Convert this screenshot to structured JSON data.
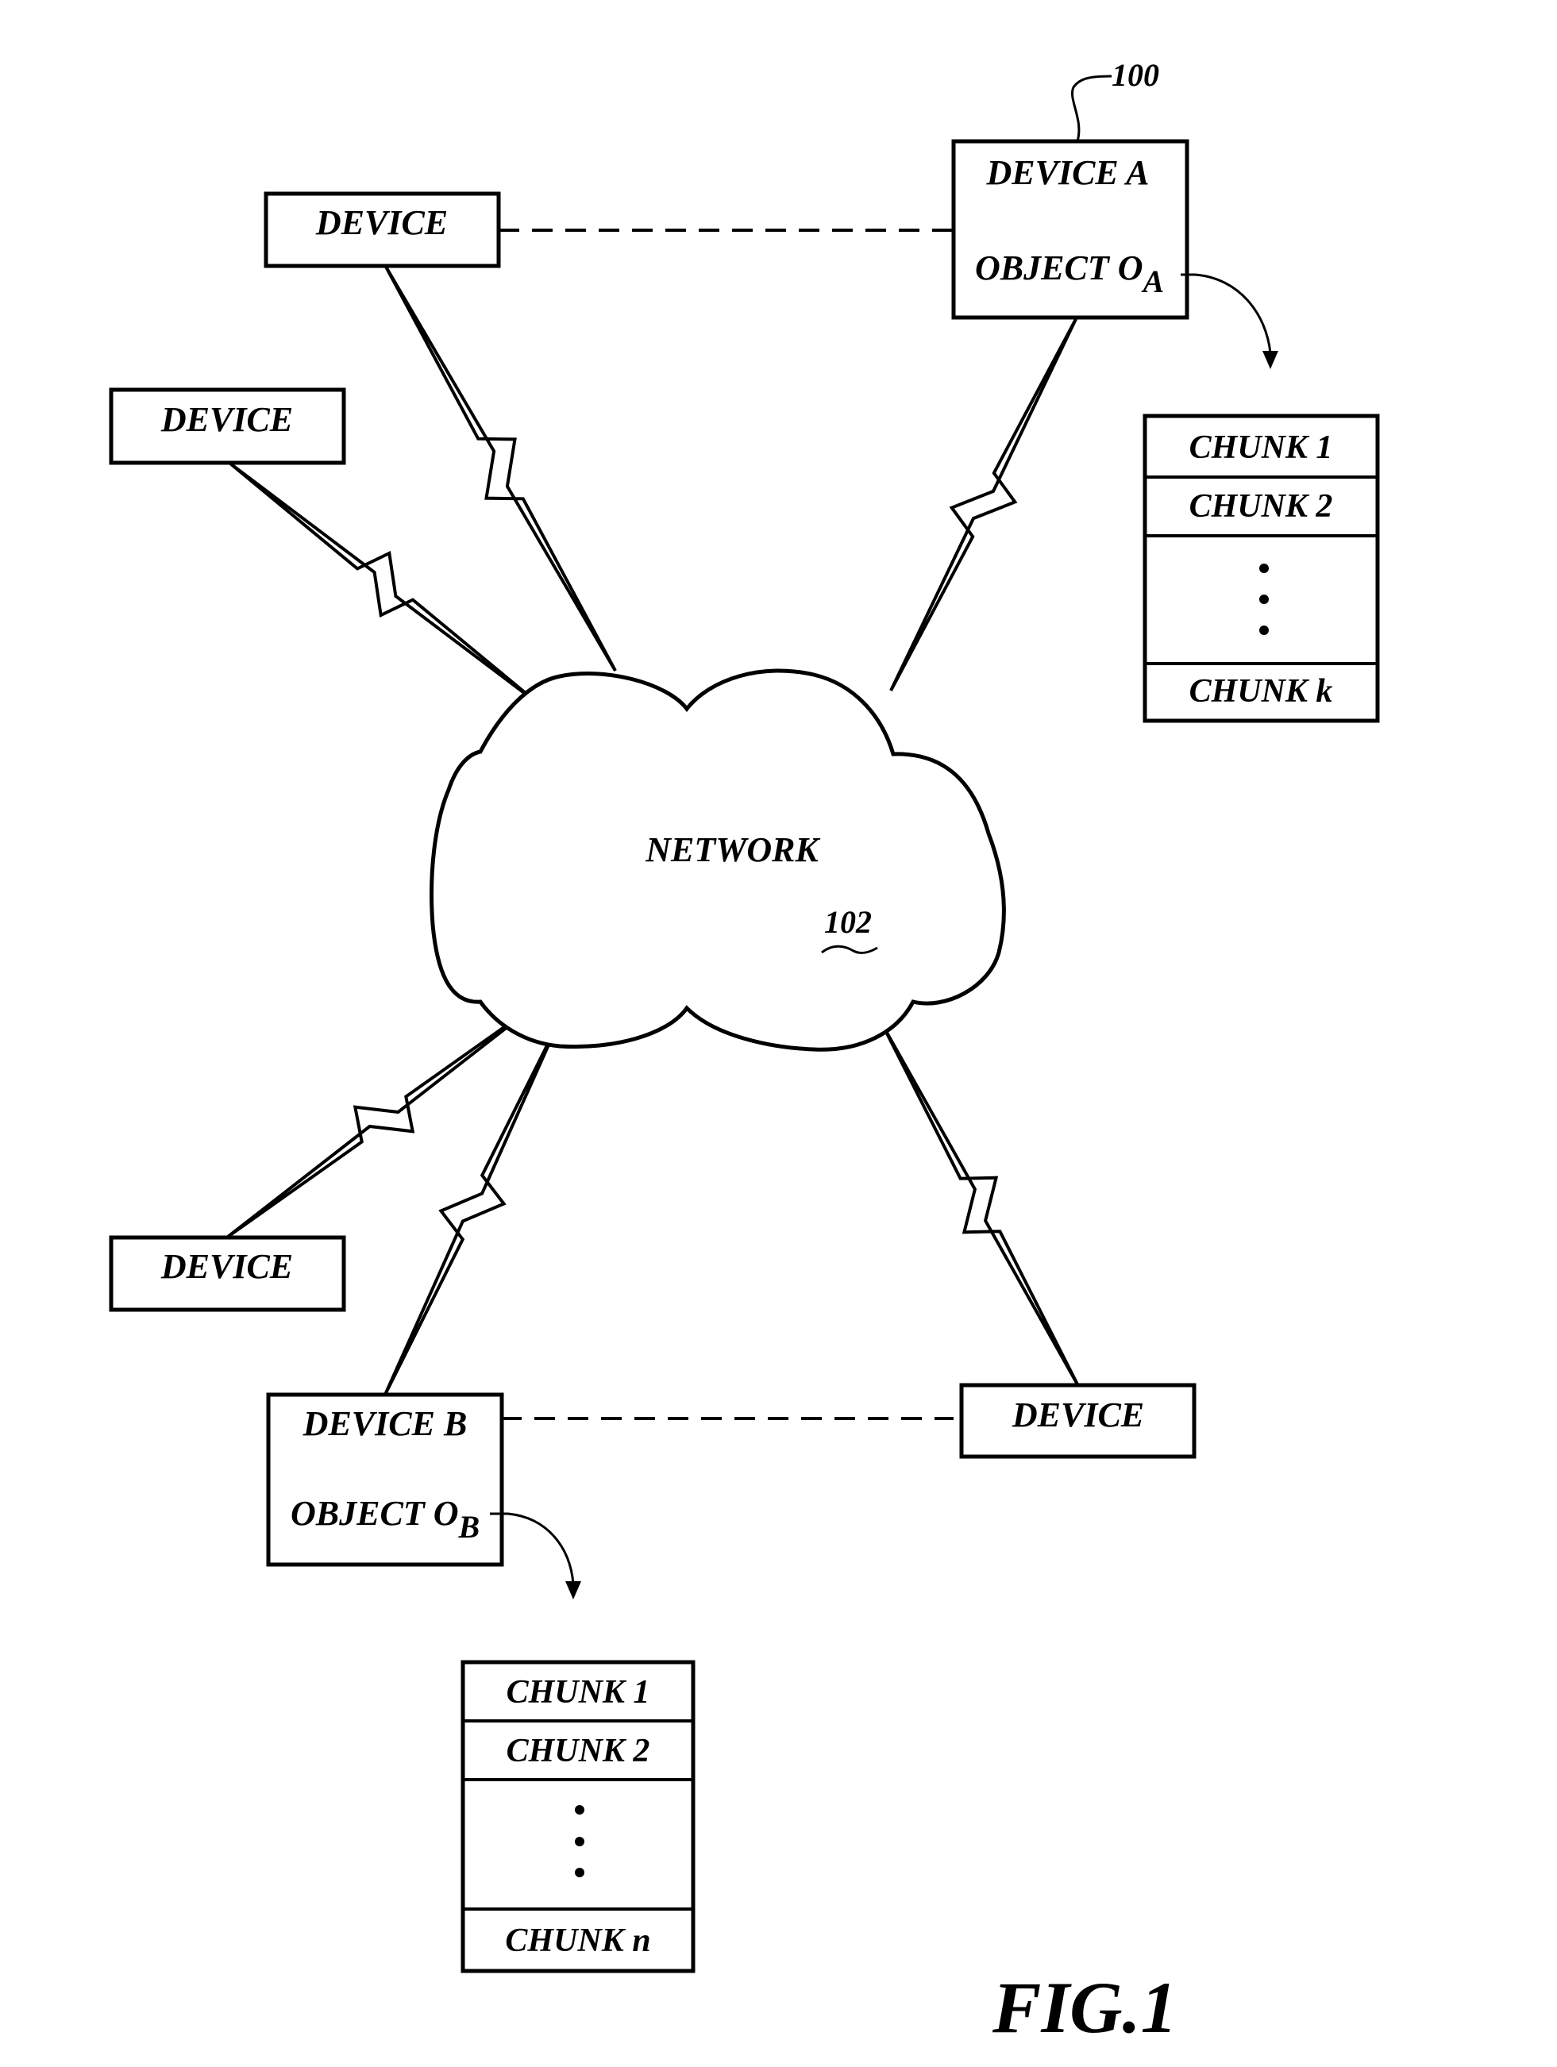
{
  "figure": {
    "label": "FIG.1",
    "system_ref": "100",
    "network": {
      "label": "NETWORK",
      "ref": "102"
    },
    "devices": [
      {
        "id": "device-top",
        "label": "DEVICE"
      },
      {
        "id": "device-left",
        "label": "DEVICE"
      },
      {
        "id": "device-a",
        "label": "DEVICE A",
        "object": "OBJECT O",
        "object_sub": "A"
      },
      {
        "id": "device-lower-left",
        "label": "DEVICE"
      },
      {
        "id": "device-b",
        "label": "DEVICE B",
        "object": "OBJECT O",
        "object_sub": "B"
      },
      {
        "id": "device-lower-right",
        "label": "DEVICE"
      }
    ],
    "chunk_lists": [
      {
        "owner": "device-a",
        "items": [
          "CHUNK 1",
          "CHUNK 2",
          "⋮",
          "CHUNK k"
        ]
      },
      {
        "owner": "device-b",
        "items": [
          "CHUNK 1",
          "CHUNK 2",
          "⋮",
          "CHUNK n"
        ]
      }
    ],
    "connections": [
      {
        "from": "device-top",
        "to": "network",
        "type": "wireless"
      },
      {
        "from": "device-left",
        "to": "network",
        "type": "wireless"
      },
      {
        "from": "device-a",
        "to": "network",
        "type": "wireless"
      },
      {
        "from": "device-lower-left",
        "to": "network",
        "type": "wireless"
      },
      {
        "from": "device-b",
        "to": "network",
        "type": "wireless"
      },
      {
        "from": "device-lower-right",
        "to": "network",
        "type": "wireless"
      },
      {
        "from": "device-top",
        "to": "device-a",
        "type": "dashed"
      },
      {
        "from": "device-b",
        "to": "device-lower-right",
        "type": "dashed"
      }
    ]
  }
}
